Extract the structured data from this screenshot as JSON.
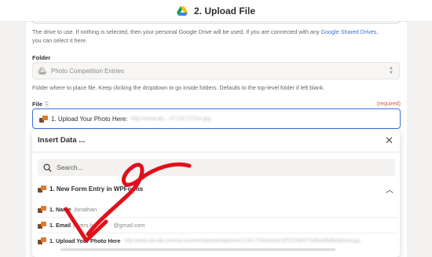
{
  "header": {
    "title": "2. Upload File",
    "icon": "google-drive-icon"
  },
  "drive_help": {
    "text_before": "The drive to use. If nothing is selected, then your personal Google Drive will be used. If you are connected with any ",
    "link": "Google Shared Drives",
    "text_after": ",",
    "line2": "you can select it here."
  },
  "folder": {
    "label": "Folder",
    "value": "Photo Competition Entries",
    "help": "Folder where to place file. Keep clicking the dropdown to go inside folders. Defaults to the top-level folder if left blank."
  },
  "file": {
    "label": "File",
    "required": "(required)",
    "pill_label": "1. Upload Your Photo Here:",
    "pill_value_blurred": "http://www.ab...-07131727/ex.jpg"
  },
  "insert_data": {
    "title": "Insert Data ...",
    "search_placeholder": "Search...",
    "group_label": "1. New Form Entry in WPForms",
    "items": [
      {
        "key": "1. Name",
        "value": "Jonathan"
      },
      {
        "key": "1. Email",
        "value": "jbyers.ha",
        "value_end": "@gmail.com"
      },
      {
        "key": "1. Upload Your Photo Here",
        "value_blurred": "http://www.ab-site.com/wp-content/uploads/wpforms/1730-7785c6a9a13f7f72e8077546aef5dfb5/photo.jpg"
      }
    ]
  },
  "colors": {
    "accent": "#3d6ed9",
    "required": "#d9534f",
    "arrow": "#e0101b",
    "wpforms_orange": "#e07a30"
  }
}
